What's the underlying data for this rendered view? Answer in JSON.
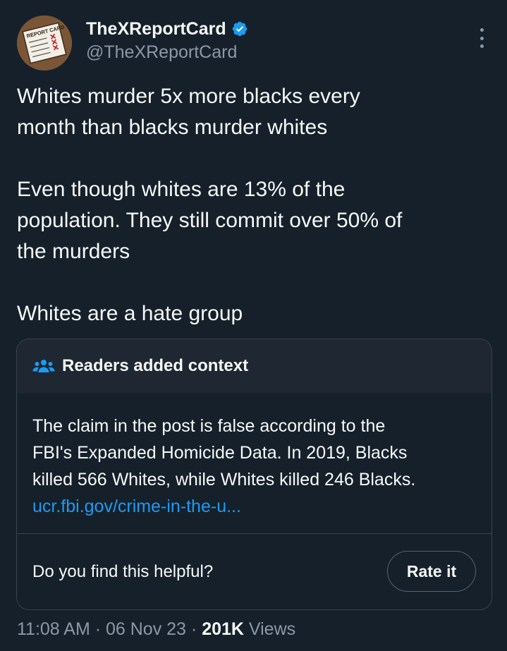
{
  "author": {
    "display_name": "TheXReportCard",
    "handle": "@TheXReportCard",
    "avatar_text": "REPORT CARD",
    "verified_color": "#1d9bf0"
  },
  "tweet": {
    "paragraphs": [
      [
        "Whites murder 5x more blacks every",
        "month than blacks murder whites"
      ],
      [
        "Even though whites are 13% of the",
        "population. They still commit over 50% of",
        "the murders"
      ],
      [
        "Whites are a hate group"
      ]
    ]
  },
  "context": {
    "title": "Readers added context",
    "note_lines": [
      "The claim in the post is false according to the",
      "FBI's Expanded Homicide Data. In 2019, Blacks",
      "killed 566 Whites, while Whites killed 246 Blacks."
    ],
    "link": "ucr.fbi.gov/crime-in-the-u...",
    "helpful_question": "Do you find this helpful?",
    "rate_label": "Rate it"
  },
  "meta": {
    "time": "11:08 AM",
    "sep1": " · ",
    "date": "06 Nov 23",
    "sep2": " · ",
    "views_count": "201K",
    "views_label": " Views"
  },
  "colors": {
    "background": "#15202b",
    "card_header": "#1e2732",
    "border": "#38444d",
    "accent": "#1d9bf0",
    "secondary_text": "#8b98a5"
  }
}
